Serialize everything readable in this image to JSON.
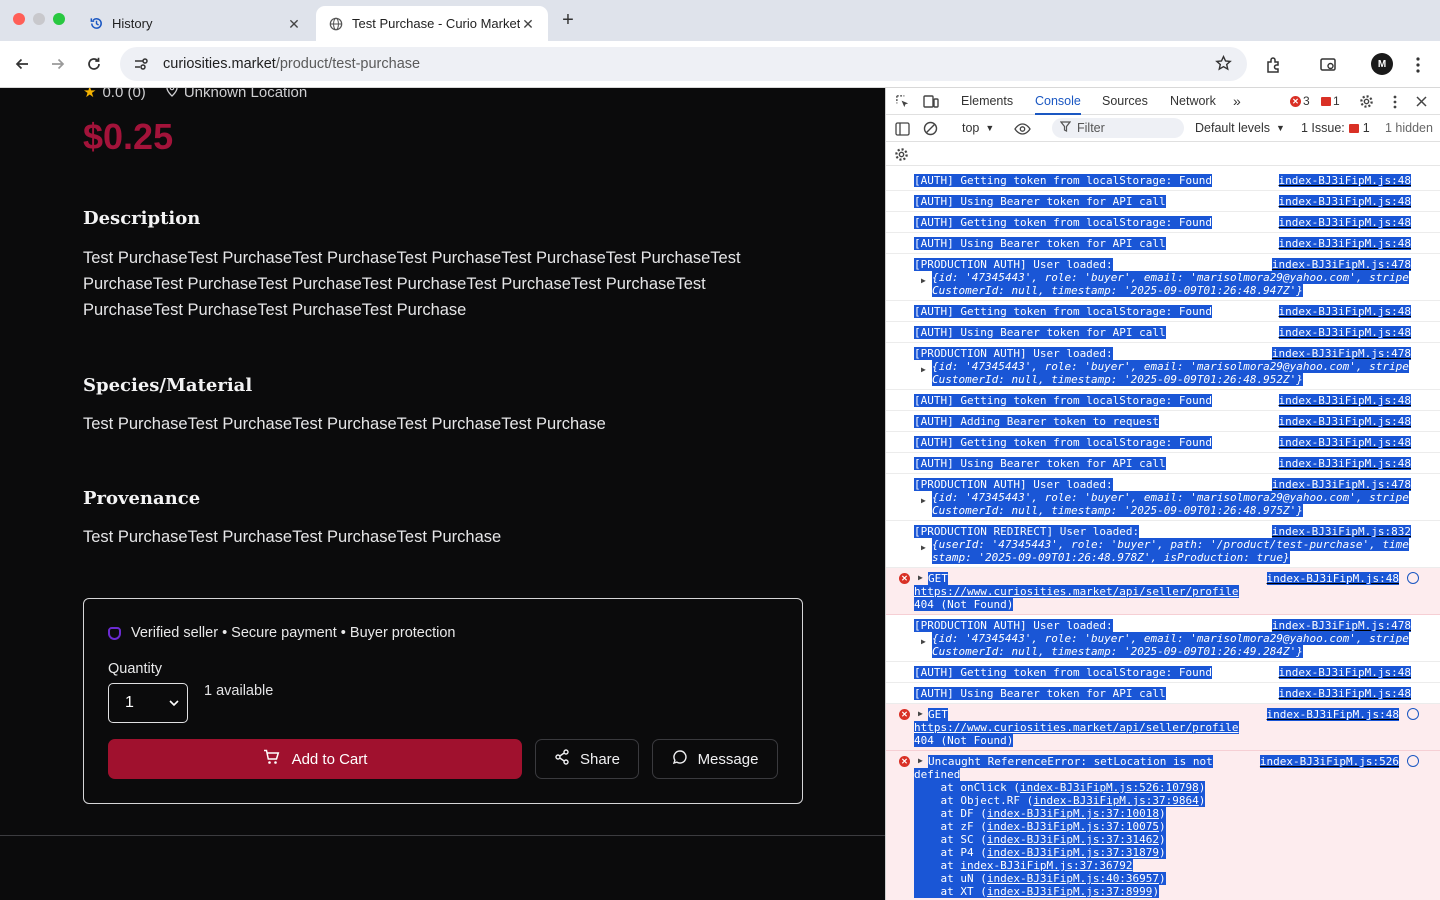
{
  "browser": {
    "tabs": [
      {
        "title": "History",
        "active": false
      },
      {
        "title": "Test Purchase - Curio Market",
        "active": true
      }
    ],
    "url_domain": "curiosities.market",
    "url_path": "/product/test-purchase",
    "profile_initial": "M"
  },
  "product": {
    "rating": "0.0 (0)",
    "location": "Unknown Location",
    "price": "$0.25",
    "sections": [
      {
        "heading": "Description",
        "text": "Test PurchaseTest PurchaseTest PurchaseTest PurchaseTest PurchaseTest PurchaseTest PurchaseTest PurchaseTest PurchaseTest PurchaseTest PurchaseTest PurchaseTest PurchaseTest PurchaseTest PurchaseTest Purchase"
      },
      {
        "heading": "Species/Material",
        "text": "Test PurchaseTest PurchaseTest PurchaseTest PurchaseTest Purchase"
      },
      {
        "heading": "Provenance",
        "text": "Test PurchaseTest PurchaseTest PurchaseTest Purchase"
      }
    ],
    "trust_text": "Verified seller • Secure payment • Buyer protection",
    "quantity_label": "Quantity",
    "quantity_value": "1",
    "available": "1 available",
    "add_to_cart": "Add to Cart",
    "share": "Share",
    "message": "Message"
  },
  "devtools": {
    "tabs": [
      "Elements",
      "Console",
      "Sources",
      "Network"
    ],
    "active_tab": "Console",
    "error_count": "3",
    "issue_count": "1",
    "context": "top",
    "filter_placeholder": "Filter",
    "levels": "Default levels",
    "issues_label": "1 Issue:",
    "issues_badge": "1",
    "hidden": "1 hidden",
    "logs": [
      {
        "type": "log",
        "lines": [
          "[AUTH] Getting token from localStorage: Found"
        ],
        "src": "index-BJ3iFipM.js:48"
      },
      {
        "type": "log",
        "lines": [
          "[AUTH] Using Bearer token for API call"
        ],
        "src": "index-BJ3iFipM.js:48"
      },
      {
        "type": "log",
        "lines": [
          "[AUTH] Getting token from localStorage: Found"
        ],
        "src": "index-BJ3iFipM.js:48"
      },
      {
        "type": "log",
        "lines": [
          "[AUTH] Using Bearer token for API call"
        ],
        "src": "index-BJ3iFipM.js:48"
      },
      {
        "type": "obj",
        "lines": [
          "[PRODUCTION AUTH] User loaded:",
          "{id: '47345443', role: 'buyer', email: 'marisolmora29@yahoo.com', stripe",
          "CustomerId: null, timestamp: '2025-09-09T01:26:48.947Z'}"
        ],
        "src": "index-BJ3iFipM.js:478"
      },
      {
        "type": "log",
        "lines": [
          "[AUTH] Getting token from localStorage: Found"
        ],
        "src": "index-BJ3iFipM.js:48"
      },
      {
        "type": "log",
        "lines": [
          "[AUTH] Using Bearer token for API call"
        ],
        "src": "index-BJ3iFipM.js:48"
      },
      {
        "type": "obj",
        "lines": [
          "[PRODUCTION AUTH] User loaded:",
          "{id: '47345443', role: 'buyer', email: 'marisolmora29@yahoo.com', stripe",
          "CustomerId: null, timestamp: '2025-09-09T01:26:48.952Z'}"
        ],
        "src": "index-BJ3iFipM.js:478"
      },
      {
        "type": "log",
        "lines": [
          "[AUTH] Getting token from localStorage: Found"
        ],
        "src": "index-BJ3iFipM.js:48"
      },
      {
        "type": "log",
        "lines": [
          "[AUTH] Adding Bearer token to request"
        ],
        "src": "index-BJ3iFipM.js:48"
      },
      {
        "type": "log",
        "lines": [
          "[AUTH] Getting token from localStorage: Found"
        ],
        "src": "index-BJ3iFipM.js:48"
      },
      {
        "type": "log",
        "lines": [
          "[AUTH] Using Bearer token for API call"
        ],
        "src": "index-BJ3iFipM.js:48"
      },
      {
        "type": "obj",
        "lines": [
          "[PRODUCTION AUTH] User loaded:",
          "{id: '47345443', role: 'buyer', email: 'marisolmora29@yahoo.com', stripe",
          "CustomerId: null, timestamp: '2025-09-09T01:26:48.975Z'}"
        ],
        "src": "index-BJ3iFipM.js:478"
      },
      {
        "type": "obj",
        "lines": [
          "[PRODUCTION REDIRECT] User loaded:",
          "{userId: '47345443', role: 'buyer', path: '/product/test-purchase', time",
          "stamp: '2025-09-09T01:26:48.978Z', isProduction: true}"
        ],
        "src": "index-BJ3iFipM.js:832"
      },
      {
        "type": "error",
        "lines": [
          "GET",
          "https://www.curiosities.market/api/seller/profile",
          "404 (Not Found)"
        ],
        "src": "index-BJ3iFipM.js:48"
      },
      {
        "type": "obj",
        "lines": [
          "[PRODUCTION AUTH] User loaded:",
          "{id: '47345443', role: 'buyer', email: 'marisolmora29@yahoo.com', stripe",
          "CustomerId: null, timestamp: '2025-09-09T01:26:49.284Z'}"
        ],
        "src": "index-BJ3iFipM.js:478"
      },
      {
        "type": "log",
        "lines": [
          "[AUTH] Getting token from localStorage: Found"
        ],
        "src": "index-BJ3iFipM.js:48"
      },
      {
        "type": "log",
        "lines": [
          "[AUTH] Using Bearer token for API call"
        ],
        "src": "index-BJ3iFipM.js:48"
      },
      {
        "type": "error",
        "lines": [
          "GET",
          "https://www.curiosities.market/api/seller/profile",
          "404 (Not Found)"
        ],
        "src": "index-BJ3iFipM.js:48"
      },
      {
        "type": "exception",
        "lines": [
          "Uncaught ReferenceError: setLocation is not",
          "defined"
        ],
        "src": "index-BJ3iFipM.js:526",
        "stack": [
          [
            "    at onClick (",
            "index-BJ3iFipM.js:526:10798",
            ")"
          ],
          [
            "    at Object.RF (",
            "index-BJ3iFipM.js:37:9864",
            ")"
          ],
          [
            "    at DF (",
            "index-BJ3iFipM.js:37:10018",
            ")"
          ],
          [
            "    at zF (",
            "index-BJ3iFipM.js:37:10075",
            ")"
          ],
          [
            "    at SC (",
            "index-BJ3iFipM.js:37:31462",
            ")"
          ],
          [
            "    at P4 (",
            "index-BJ3iFipM.js:37:31879",
            ")"
          ],
          [
            "    at ",
            "index-BJ3iFipM.js:37:36792",
            ""
          ],
          [
            "    at uN (",
            "index-BJ3iFipM.js:40:36957",
            ")"
          ],
          [
            "    at XT (",
            "index-BJ3iFipM.js:37:8999",
            ")"
          ]
        ]
      }
    ]
  }
}
